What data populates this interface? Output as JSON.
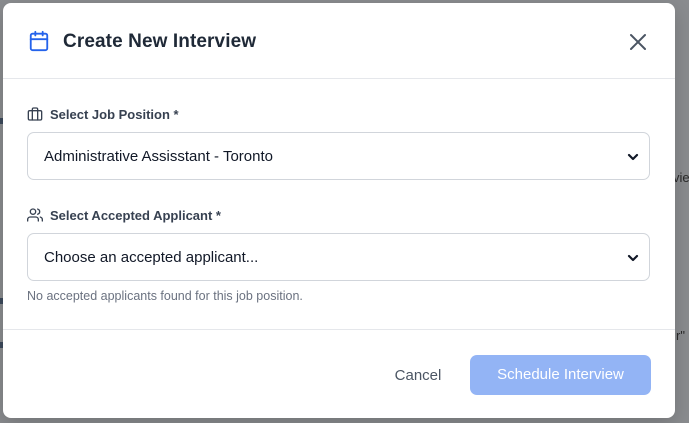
{
  "background": {
    "fragment_right": "vie",
    "fragment_quote": "r\""
  },
  "modal": {
    "title": "Create New Interview",
    "header_icon": "calendar-icon",
    "close_icon": "close-icon"
  },
  "form": {
    "job_position": {
      "label": "Select Job Position *",
      "icon": "briefcase-icon",
      "selected": "Administrative Assisstant - Toronto"
    },
    "applicant": {
      "label": "Select Accepted Applicant *",
      "icon": "users-icon",
      "selected": "Choose an accepted applicant...",
      "helper": "No accepted applicants found for this job position."
    }
  },
  "footer": {
    "cancel_label": "Cancel",
    "submit_label": "Schedule Interview",
    "submit_disabled": true
  },
  "colors": {
    "primary_disabled": "#93b4f5",
    "accent_icon": "#2563eb",
    "overlay": "#8a8c8f"
  }
}
